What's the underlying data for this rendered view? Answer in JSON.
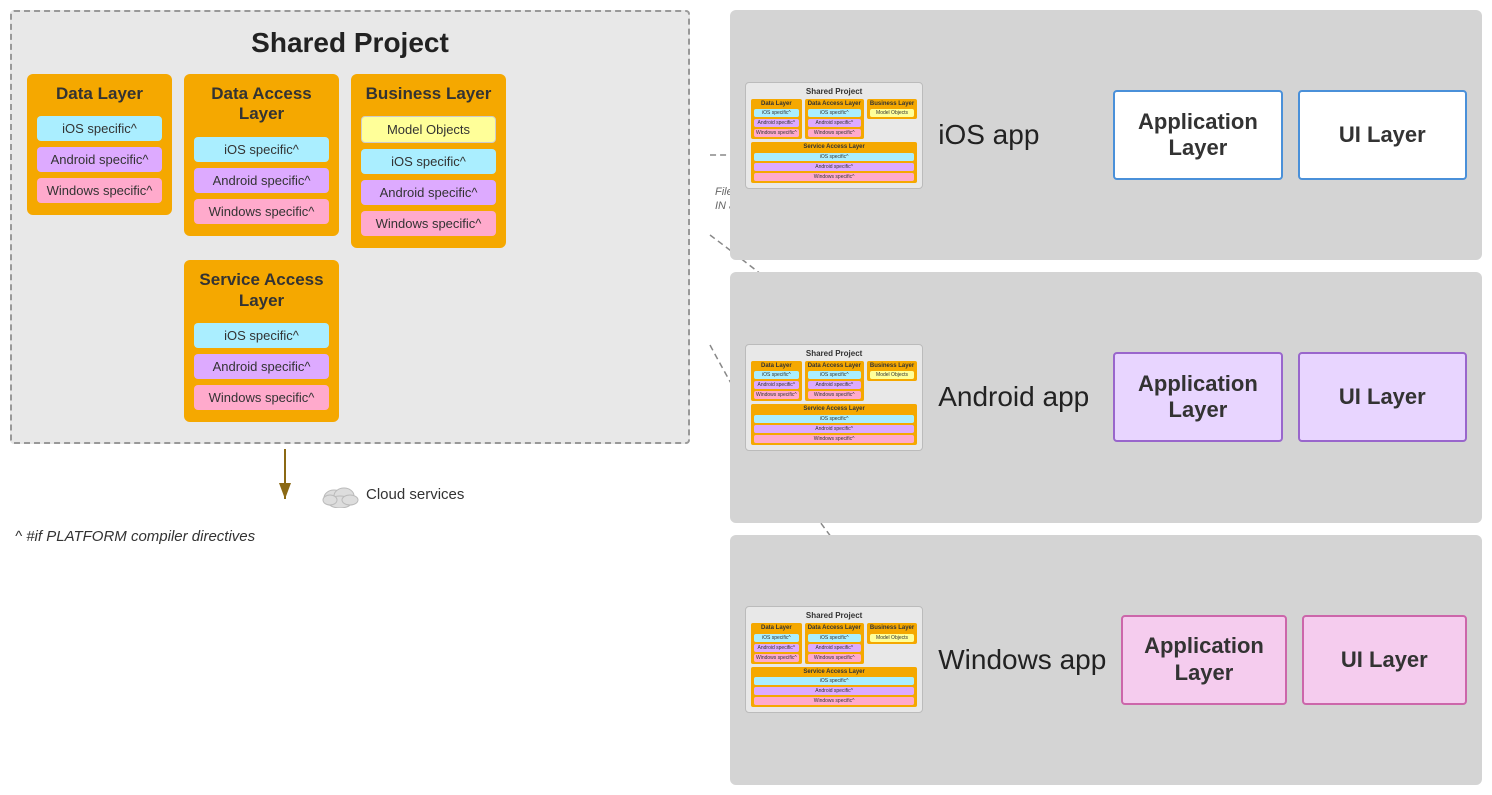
{
  "leftPanel": {
    "sharedProject": {
      "title": "Shared Project",
      "dataLayer": {
        "title": "Data Layer",
        "ios": "iOS specific^",
        "android": "Android specific^",
        "windows": "Windows specific^"
      },
      "dataAccessLayer": {
        "title": "Data Access Layer",
        "ios": "iOS specific^",
        "android": "Android specific^",
        "windows": "Windows specific^"
      },
      "businessLayer": {
        "title": "Business Layer",
        "modelObjects": "Model Objects",
        "ios": "iOS specific^",
        "android": "Android specific^",
        "windows": "Windows specific^"
      },
      "serviceAccessLayer": {
        "title": "Service Access Layer",
        "ios": "iOS specific^",
        "android": "Android specific^",
        "windows": "Windows specific^"
      }
    },
    "cloudLabel": "Cloud services",
    "footnote": "^ #if PLATFORM compiler directives",
    "filesLabel": "Files compiled IN app"
  },
  "rightPanel": {
    "ios": {
      "title": "iOS app",
      "appLayer": "Application Layer",
      "uiLayer": "UI Layer",
      "mini": {
        "title": "Shared Project"
      }
    },
    "android": {
      "title": "Android app",
      "appLayer": "Application Layer",
      "uiLayer": "UI Layer",
      "mini": {
        "title": "Shared Project"
      }
    },
    "windows": {
      "title": "Windows app",
      "appLayer": "Application Layer",
      "uiLayer": "UI Layer",
      "mini": {
        "title": "Shared Project"
      }
    }
  }
}
